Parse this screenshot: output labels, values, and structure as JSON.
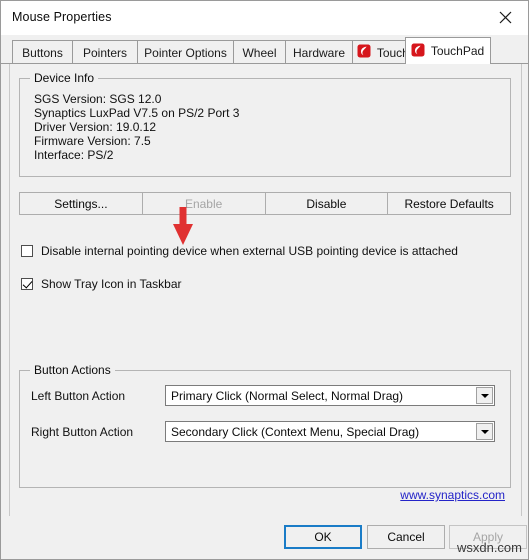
{
  "window": {
    "title": "Mouse Properties",
    "close_icon": "close-icon"
  },
  "tabs": [
    {
      "label": "Buttons",
      "active": false,
      "icon": null
    },
    {
      "label": "Pointers",
      "active": false,
      "icon": null
    },
    {
      "label": "Pointer Options",
      "active": false,
      "icon": null
    },
    {
      "label": "Wheel",
      "active": false,
      "icon": null
    },
    {
      "label": "Hardware",
      "active": false,
      "icon": null
    },
    {
      "label": "TouchStyk",
      "active": false,
      "icon": "synaptics-logo-icon"
    },
    {
      "label": "TouchPad",
      "active": true,
      "icon": "synaptics-logo-icon"
    }
  ],
  "device_info": {
    "group_title": "Device Info",
    "lines": [
      "SGS Version: SGS 12.0",
      "Synaptics LuxPad V7.5 on PS/2 Port 3",
      "Driver Version: 19.0.12",
      "Firmware Version: 7.5",
      "Interface: PS/2"
    ]
  },
  "annotation": {
    "type": "red-arrow-down",
    "color": "#e03131",
    "points_at": "Enable"
  },
  "device_buttons": [
    {
      "label": "Settings...",
      "disabled": false
    },
    {
      "label": "Enable",
      "disabled": true
    },
    {
      "label": "Disable",
      "disabled": false
    },
    {
      "label": "Restore Defaults",
      "disabled": false
    }
  ],
  "checkboxes": [
    {
      "label": "Disable internal pointing device when external USB pointing device is attached",
      "checked": false
    },
    {
      "label": "Show Tray Icon in Taskbar",
      "checked": true
    }
  ],
  "button_actions": {
    "group_title": "Button Actions",
    "rows": [
      {
        "label": "Left Button Action",
        "value": "Primary Click (Normal Select, Normal Drag)"
      },
      {
        "label": "Right Button Action",
        "value": "Secondary Click (Context Menu, Special Drag)"
      }
    ]
  },
  "link": {
    "text": "www.synaptics.com",
    "color": "#2424c8"
  },
  "footer": {
    "ok": "OK",
    "cancel": "Cancel",
    "apply": "Apply",
    "apply_disabled": true
  },
  "watermark": "wsxdn.com"
}
